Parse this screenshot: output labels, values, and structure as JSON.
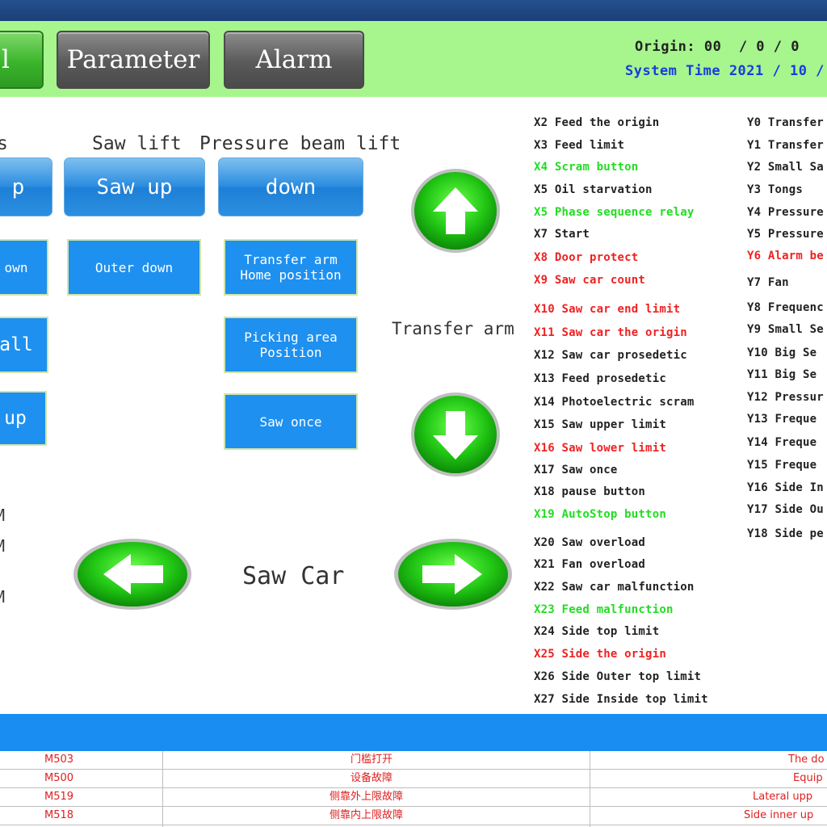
{
  "header": {
    "tabs": [
      {
        "label": "l",
        "style": "green"
      },
      {
        "label": "Parameter",
        "style": "gray"
      },
      {
        "label": "Alarm",
        "style": "gray"
      }
    ],
    "origin_text": "Origin: 00  / 0 / 0",
    "system_time_text": "System Time 2021 / 10 /"
  },
  "manual": {
    "group_labels": [
      "s",
      "Saw lift",
      "Pressure beam lift"
    ],
    "buttons": {
      "col0_up": "p",
      "saw_up": "Saw up",
      "beam_down": "down",
      "col0_down": "own",
      "outer_down": "Outer down",
      "transfer_home": "Transfer arm\nHome position",
      "col0_small": "all",
      "picking_area": "Picking area\nPosition",
      "col0_up2": " up",
      "saw_once": "Saw once"
    },
    "left_fragments": [
      "M",
      "M",
      "M"
    ],
    "transfer_arm_label": "Transfer arm",
    "saw_car_label": "Saw Car",
    "arrow_icons": [
      "arrow-up-icon",
      "arrow-down-icon",
      "arrow-left-icon",
      "arrow-right-icon"
    ]
  },
  "io_status": {
    "inputs": [
      {
        "text": "X2 Feed the origin",
        "color": "#222222"
      },
      {
        "text": "X3 Feed limit",
        "color": "#222222"
      },
      {
        "text": "X4 Scram button",
        "color": "#22dd22"
      },
      {
        "text": "X5 Oil starvation",
        "color": "#222222"
      },
      {
        "text": "X5 Phase sequence relay",
        "color": "#22dd22"
      },
      {
        "text": "X7 Start",
        "color": "#222222"
      },
      {
        "text": "X8 Door protect",
        "color": "#ee2222"
      },
      {
        "text": "X9 Saw car count",
        "color": "#ee2222"
      },
      {
        "text": "X10 Saw car end limit",
        "color": "#ee2222"
      },
      {
        "text": "X11 Saw car the origin",
        "color": "#ee2222"
      },
      {
        "text": "X12 Saw car prosedetic",
        "color": "#222222"
      },
      {
        "text": "X13 Feed prosedetic",
        "color": "#222222"
      },
      {
        "text": "X14 Photoelectric scram",
        "color": "#222222"
      },
      {
        "text": "X15 Saw upper limit",
        "color": "#222222"
      },
      {
        "text": "X16 Saw lower limit",
        "color": "#ee2222"
      },
      {
        "text": "X17 Saw once",
        "color": "#222222"
      },
      {
        "text": "X18 pause button",
        "color": "#222222"
      },
      {
        "text": "X19 AutoStop button",
        "color": "#22dd22"
      },
      {
        "text": "X20 Saw overload",
        "color": "#222222"
      },
      {
        "text": "X21 Fan overload",
        "color": "#222222"
      },
      {
        "text": "X22 Saw car malfunction",
        "color": "#222222"
      },
      {
        "text": "X23 Feed malfunction",
        "color": "#22dd22"
      },
      {
        "text": "X24 Side top limit",
        "color": "#222222"
      },
      {
        "text": "X25 Side the origin",
        "color": "#ee2222"
      },
      {
        "text": "X26 Side Outer top limit",
        "color": "#222222"
      },
      {
        "text": "X27 Side Inside top limit",
        "color": "#222222"
      }
    ],
    "outputs": [
      {
        "text": "Y0 Transfer",
        "color": "#222222"
      },
      {
        "text": "Y1 Transfer",
        "color": "#222222"
      },
      {
        "text": "Y2 Small Sa",
        "color": "#222222"
      },
      {
        "text": "Y3 Tongs",
        "color": "#222222"
      },
      {
        "text": "Y4 Pressure",
        "color": "#222222"
      },
      {
        "text": "Y5 Pressure",
        "color": "#222222"
      },
      {
        "text": "Y6 Alarm be",
        "color": "#ee2222"
      },
      {
        "text": "Y7 Fan",
        "color": "#222222"
      },
      {
        "text": "Y8 Frequenc",
        "color": "#222222"
      },
      {
        "text": "Y9 Small Se",
        "color": "#222222"
      },
      {
        "text": "Y10 Big Se",
        "color": "#222222"
      },
      {
        "text": "Y11 Big Se",
        "color": "#222222"
      },
      {
        "text": "Y12 Pressur",
        "color": "#222222"
      },
      {
        "text": "Y13 Freque",
        "color": "#222222"
      },
      {
        "text": "Y14 Freque",
        "color": "#222222"
      },
      {
        "text": "Y15 Freque",
        "color": "#222222"
      },
      {
        "text": "Y16 Side In",
        "color": "#222222"
      },
      {
        "text": "Y17 Side Ou",
        "color": "#222222"
      },
      {
        "text": "Y18 Side pe",
        "color": "#222222"
      }
    ]
  },
  "alarm_table": {
    "rows": [
      {
        "code": "M503",
        "cn": "门槛打开",
        "en": "The do"
      },
      {
        "code": "M500",
        "cn": "设备故障",
        "en": "Equip"
      },
      {
        "code": "M519",
        "cn": "侧靠外上限故障",
        "en": "Lateral upp"
      },
      {
        "code": "M518",
        "cn": "侧靠内上限故障",
        "en": "Side inner up"
      }
    ]
  },
  "colors": {
    "header_bg": "#a6f58d",
    "top_bar": "#1b3f77",
    "button_blue": "#1e90f0",
    "status_bar": "#1a8df2",
    "active_green": "#22dd22",
    "alarm_red": "#ee2222",
    "time_blue": "#1a3ae0"
  }
}
